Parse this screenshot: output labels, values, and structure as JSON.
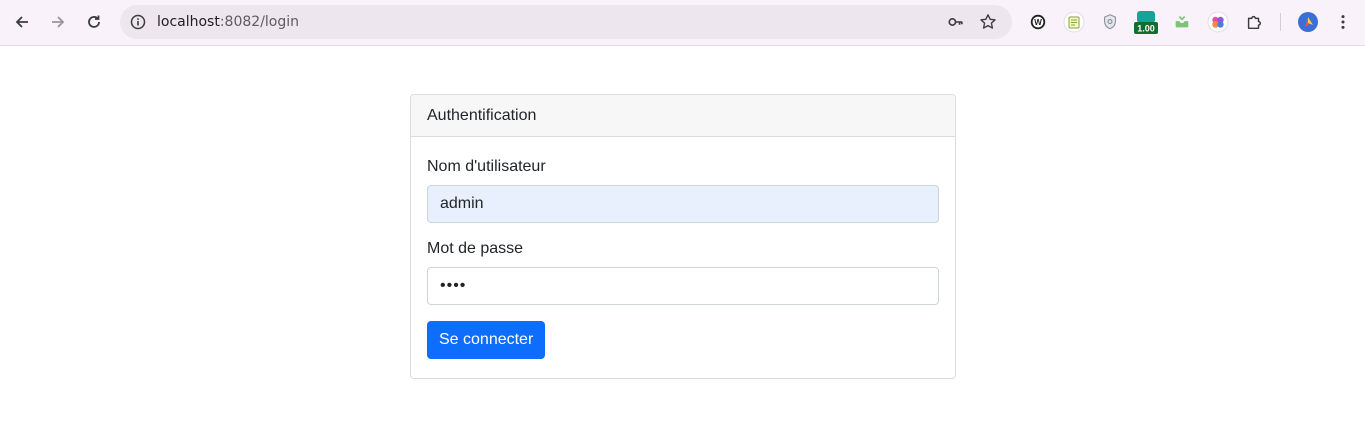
{
  "browser": {
    "url_host": "localhost",
    "url_path": ":8082/login",
    "icons": {
      "back": "back-arrow-icon",
      "forward": "forward-arrow-icon",
      "reload": "reload-icon",
      "site_info": "info-icon",
      "password_key": "key-icon",
      "bookmark": "star-icon"
    },
    "extensions": {
      "badge_value": "1.00"
    }
  },
  "login": {
    "header": "Authentification",
    "username_label": "Nom d'utilisateur",
    "username_value": "admin",
    "password_label": "Mot de passe",
    "password_value": "••••",
    "submit_label": "Se connecter"
  },
  "colors": {
    "primary": "#0d6efd",
    "autofill_bg": "#e8f0fe"
  }
}
